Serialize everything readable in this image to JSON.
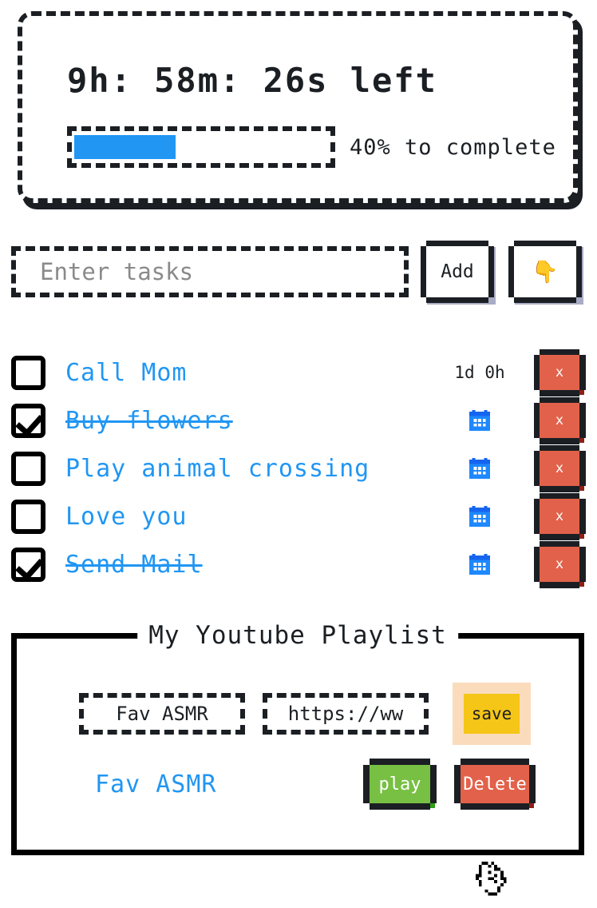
{
  "timer": {
    "countdown": "9h: 58m: 26s left",
    "progress_percent": 40,
    "progress_label": "40% to complete",
    "fill_color": "#2196f3"
  },
  "task_entry": {
    "placeholder": "Enter tasks",
    "value": "",
    "add_label": "Add",
    "hand_icon": "👇"
  },
  "tasks": [
    {
      "label": "Call Mom",
      "checked": false,
      "due": "1d 0h",
      "has_calendar": false,
      "delete_label": "x"
    },
    {
      "label": "Buy flowers",
      "checked": true,
      "due": "",
      "has_calendar": true,
      "delete_label": "x"
    },
    {
      "label": "Play animal crossing",
      "checked": false,
      "due": "",
      "has_calendar": true,
      "delete_label": "x"
    },
    {
      "label": "Love you",
      "checked": false,
      "due": "",
      "has_calendar": true,
      "delete_label": "x"
    },
    {
      "label": "Send Mail",
      "checked": true,
      "due": "",
      "has_calendar": true,
      "delete_label": "x"
    }
  ],
  "playlist": {
    "title": "My Youtube Playlist",
    "name_value": "Fav ASMR",
    "name_placeholder": "Fav ASMR",
    "url_value": "https://ww",
    "url_placeholder": "https://ww",
    "save_label": "save",
    "entries": [
      {
        "name": "Fav ASMR",
        "play_label": "play",
        "delete_label": "Delete"
      }
    ]
  },
  "colors": {
    "accent_blue": "#2196f3",
    "ink": "#1b1f23",
    "danger": "#e2614a",
    "danger_shadow": "#8e1f16",
    "success": "#77c043",
    "success_shadow": "#2f9e16",
    "save_yellow": "#f5c518",
    "save_shadow": "#e08c00",
    "save_glow": "#fadcbc",
    "btn_shadow_gray": "#a9acc4"
  }
}
